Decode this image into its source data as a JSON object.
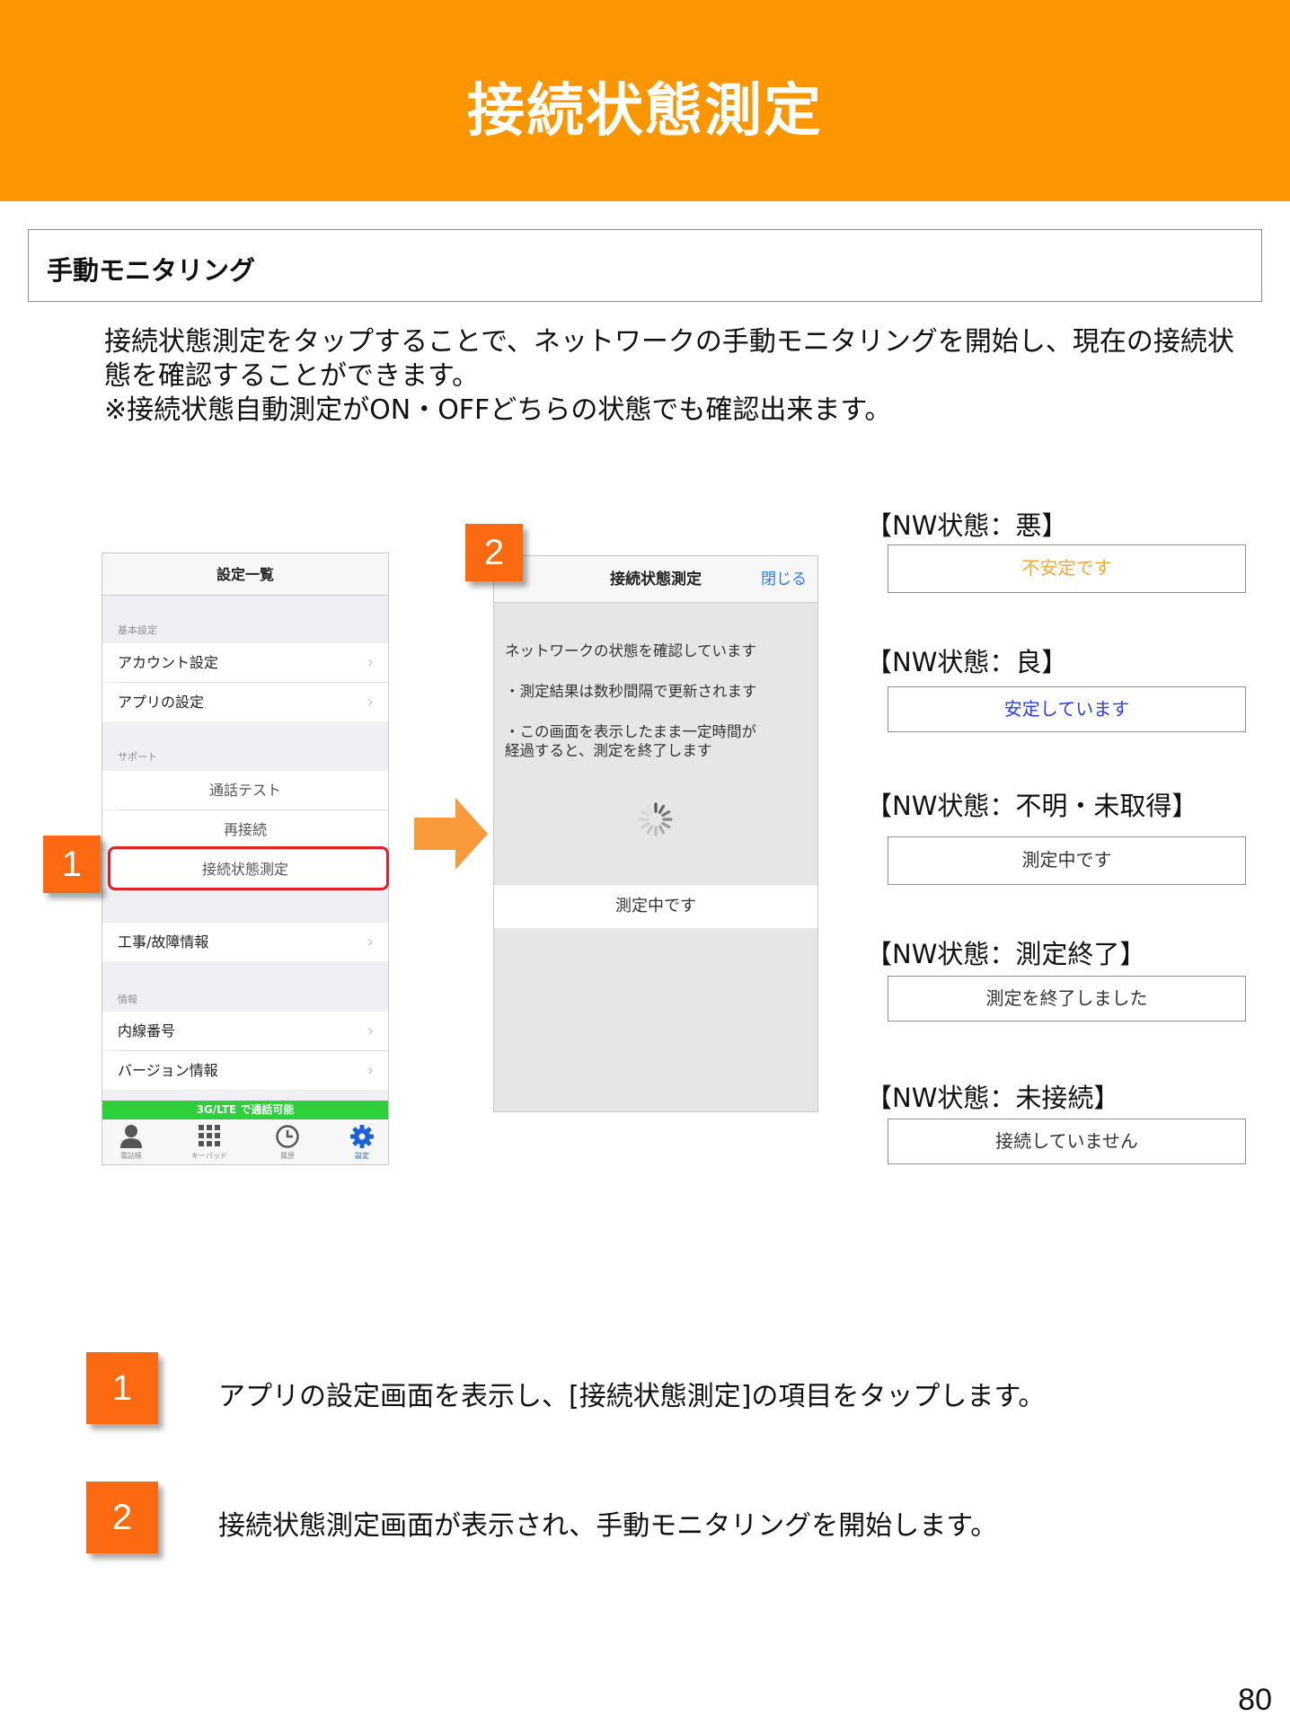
{
  "header": {
    "title": "接続状態測定"
  },
  "section": {
    "title": "手動モニタリング"
  },
  "intro": {
    "line1": "接続状態測定をタップすることで、ネットワークの手動モニタリングを開始し、現在の接続状",
    "line2": "態を確認することができます。",
    "line3": "※接続状態自動測定がON・OFFどちらの状態でも確認出来ます。"
  },
  "phone1": {
    "title": "設定一覧",
    "section_basic": "基本設定",
    "account": "アカウント設定",
    "app_settings": "アプリの設定",
    "section_support": "サポート",
    "call_test": "通話テスト",
    "reconnect": "再接続",
    "connection_measure": "接続状態測定",
    "construction": "工事/故障情報",
    "section_info": "情報",
    "extension": "内線番号",
    "version": "バージョン情報",
    "network_status": "3G/LTE で通話可能",
    "tabs": [
      "電話帳",
      "キーパッド",
      "履歴",
      "設定"
    ],
    "chevron": "›"
  },
  "phone2": {
    "title": "接続状態測定",
    "close": "閉じる",
    "line1": "ネットワークの状態を確認しています",
    "line2": "・測定結果は数秒間隔で更新されます",
    "line3": "・この画面を表示したまま一定時間が",
    "line4": "経過すると、測定を終了します",
    "status": "測定中です"
  },
  "nw_states": [
    {
      "label": "【NW状態：悪】",
      "message": "不安定です",
      "color": "#f0a830"
    },
    {
      "label": "【NW状態：良】",
      "message": "安定しています",
      "color": "#2b3de0"
    },
    {
      "label": "【NW状態：不明・未取得】",
      "message": "測定中です",
      "color": "#333333"
    },
    {
      "label": "【NW状態：測定終了】",
      "message": "測定を終了しました",
      "color": "#333333"
    },
    {
      "label": "【NW状態：未接続】",
      "message": "接続していません",
      "color": "#333333"
    }
  ],
  "badges": {
    "one": "1",
    "two": "2"
  },
  "steps": [
    {
      "number": "1",
      "text": "アプリの設定画面を表示し、[接続状態測定]の項目をタップします。"
    },
    {
      "number": "2",
      "text": "接続状態測定画面が表示され、手動モニタリングを開始します。"
    }
  ],
  "page_number": "80",
  "colors": {
    "header": "#fb9500",
    "badge": "#fb6a10",
    "highlight": "#e0202a",
    "link": "#2f7ae5",
    "network_ok": "#2dcf3a"
  }
}
